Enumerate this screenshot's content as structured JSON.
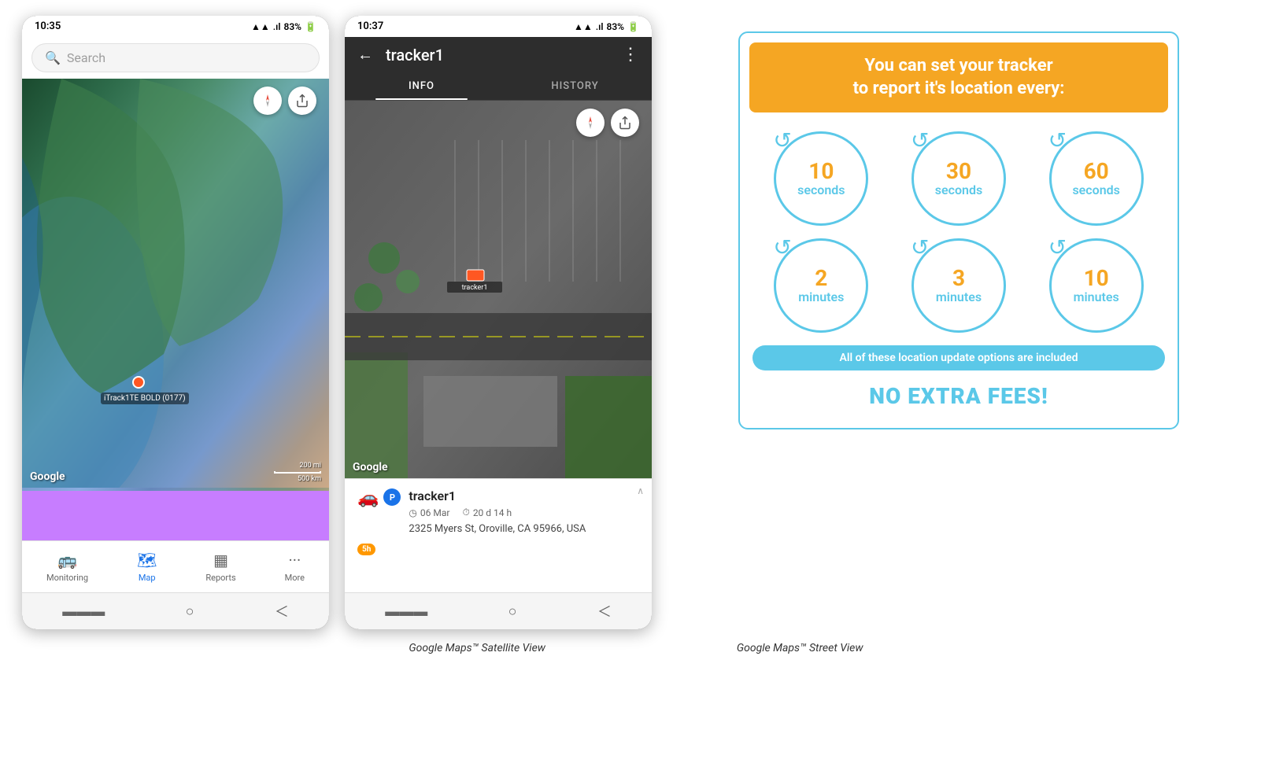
{
  "phone1": {
    "status_bar": {
      "time": "10:35",
      "signal": "▲▲▲",
      "network": ".ıl",
      "battery": "83%"
    },
    "search": {
      "placeholder": "Search"
    },
    "map": {
      "tracker_label": "iTrack1TE BOLD (0177)",
      "google_logo": "Google",
      "scale_200mi": "200 mi",
      "scale_500km": "500 km"
    },
    "nav": {
      "items": [
        {
          "label": "Monitoring",
          "icon": "🚌",
          "active": false
        },
        {
          "label": "Map",
          "icon": "🗺",
          "active": true
        },
        {
          "label": "Reports",
          "icon": "▦",
          "active": false
        },
        {
          "label": "More",
          "icon": "···",
          "active": false
        }
      ]
    },
    "caption": "Google Maps™ Satellite View"
  },
  "phone2": {
    "status_bar": {
      "time": "10:37",
      "signal": "▲▲▲",
      "network": ".ıl",
      "battery": "83%"
    },
    "header": {
      "title": "tracker1",
      "back_icon": "←",
      "more_icon": "⋮"
    },
    "tabs": [
      {
        "label": "INFO",
        "active": true
      },
      {
        "label": "HISTORY",
        "active": false
      }
    ],
    "map": {
      "google_logo": "Google",
      "tracker_label": "tracker1"
    },
    "tracker_info": {
      "name": "tracker1",
      "date": "06 Mar",
      "duration": "20 d 14 h",
      "address": "2325 Myers St, Oroville, CA 95966, USA",
      "badge": "5h"
    },
    "caption": "Google Maps™ Street View"
  },
  "info_panel": {
    "header_title": "You can set your tracker\nto report it's location every:",
    "intervals_row1": [
      {
        "value": "10",
        "unit": "seconds"
      },
      {
        "value": "30",
        "unit": "seconds"
      },
      {
        "value": "60",
        "unit": "seconds"
      }
    ],
    "intervals_row2": [
      {
        "value": "2",
        "unit": "minutes"
      },
      {
        "value": "3",
        "unit": "minutes"
      },
      {
        "value": "10",
        "unit": "minutes"
      }
    ],
    "no_fees_bar": "All of these location update options are included",
    "no_extra_fees": "NO EXTRA FEES!",
    "colors": {
      "orange": "#f5a623",
      "blue": "#5bc8e8"
    }
  }
}
